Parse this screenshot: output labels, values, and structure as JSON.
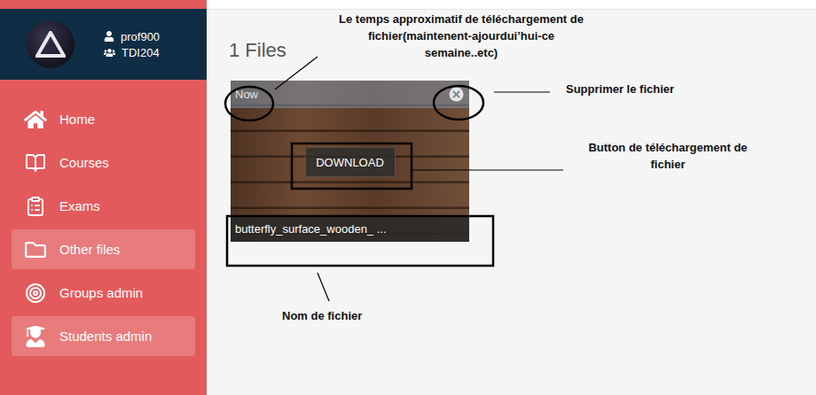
{
  "sidebar": {
    "user": {
      "name": "prof900",
      "group": "TDI204"
    },
    "items": [
      {
        "label": "Home",
        "selected": false,
        "hovered": false
      },
      {
        "label": "Courses",
        "selected": false,
        "hovered": false
      },
      {
        "label": "Exams",
        "selected": false,
        "hovered": false
      },
      {
        "label": "Other files",
        "selected": true,
        "hovered": false
      },
      {
        "label": "Groups admin",
        "selected": false,
        "hovered": false
      },
      {
        "label": "Students admin",
        "selected": false,
        "hovered": true
      }
    ]
  },
  "page": {
    "title": "1 Files"
  },
  "files": [
    {
      "time": "Now",
      "action": "DOWNLOAD",
      "name": "butterfly_surface_wooden_ ..."
    }
  ],
  "annotations": {
    "time": [
      "Le temps approximatif de téléchargement de",
      "fichier(maintenent-ajourdui’hui-ce",
      "semaine..etc)"
    ],
    "delete": "Supprimer le fichier",
    "download": [
      "Button de téléchargement de",
      "fichier"
    ],
    "name": "Nom de fichier"
  }
}
